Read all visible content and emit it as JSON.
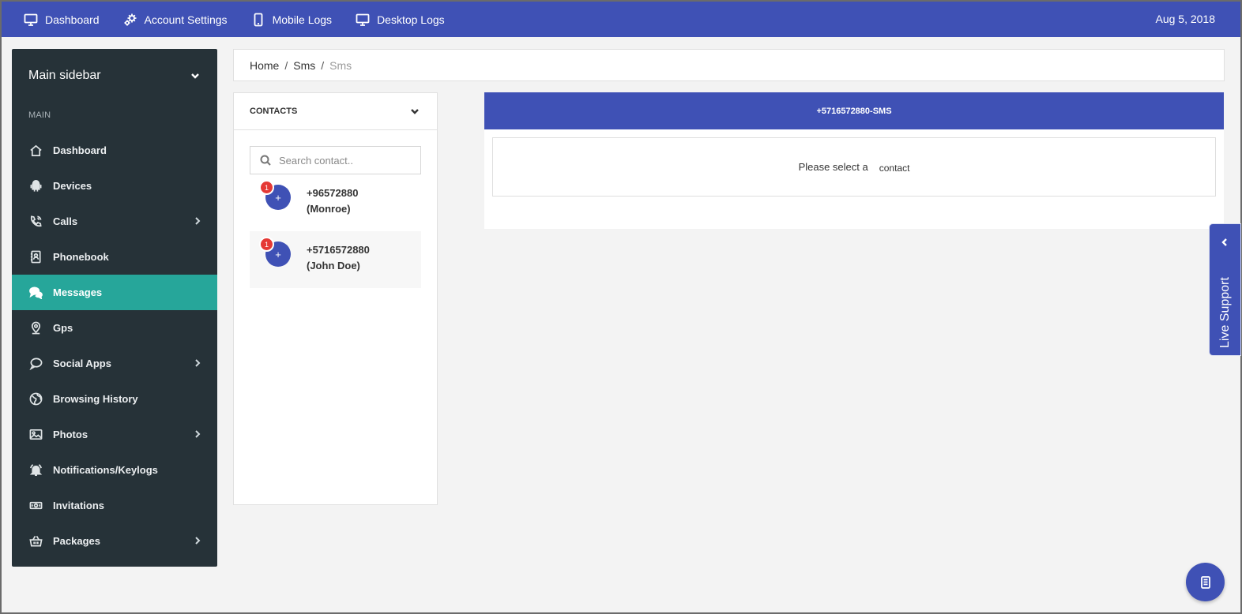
{
  "topnav": {
    "items": [
      {
        "label": "Dashboard",
        "icon": "monitor-icon"
      },
      {
        "label": "Account Settings",
        "icon": "gears-icon"
      },
      {
        "label": "Mobile Logs",
        "icon": "mobile-icon"
      },
      {
        "label": "Desktop Logs",
        "icon": "desktop-icon"
      }
    ],
    "date": "Aug 5, 2018"
  },
  "sidebar": {
    "title": "Main sidebar",
    "section": "MAIN",
    "items": [
      {
        "label": "Dashboard",
        "icon": "home-icon"
      },
      {
        "label": "Devices",
        "icon": "android-icon"
      },
      {
        "label": "Calls",
        "icon": "phone-icon"
      },
      {
        "label": "Phonebook",
        "icon": "contact-book-icon"
      },
      {
        "label": "Messages",
        "icon": "chat-bubbles-icon"
      },
      {
        "label": "Gps",
        "icon": "map-pin-icon"
      },
      {
        "label": "Social Apps",
        "icon": "speech-bubble-icon"
      },
      {
        "label": "Browsing History",
        "icon": "globe-icon"
      },
      {
        "label": "Photos",
        "icon": "image-icon"
      },
      {
        "label": "Notifications/Keylogs",
        "icon": "bell-icon"
      },
      {
        "label": "Invitations",
        "icon": "ticket-icon"
      },
      {
        "label": "Packages",
        "icon": "basket-icon"
      }
    ]
  },
  "breadcrumb": {
    "items": [
      "Home",
      "Sms",
      "Sms"
    ]
  },
  "contacts": {
    "title": "CONTACTS",
    "search_placeholder": "Search contact..",
    "list": [
      {
        "number": "+96572880",
        "name": "(Monroe)",
        "badge": "1",
        "avatar": "+"
      },
      {
        "number": "+5716572880",
        "name": "(John Doe)",
        "badge": "1",
        "avatar": "+"
      }
    ]
  },
  "sms": {
    "title": "+5716572880-SMS",
    "empty_text_1": "Please select a",
    "empty_text_2": "contact"
  },
  "live_support": {
    "label": "Live Support"
  },
  "colors": {
    "primary": "#3f51b5",
    "sidebar_bg": "#263238",
    "active": "#26a69a",
    "badge": "#e53935"
  }
}
